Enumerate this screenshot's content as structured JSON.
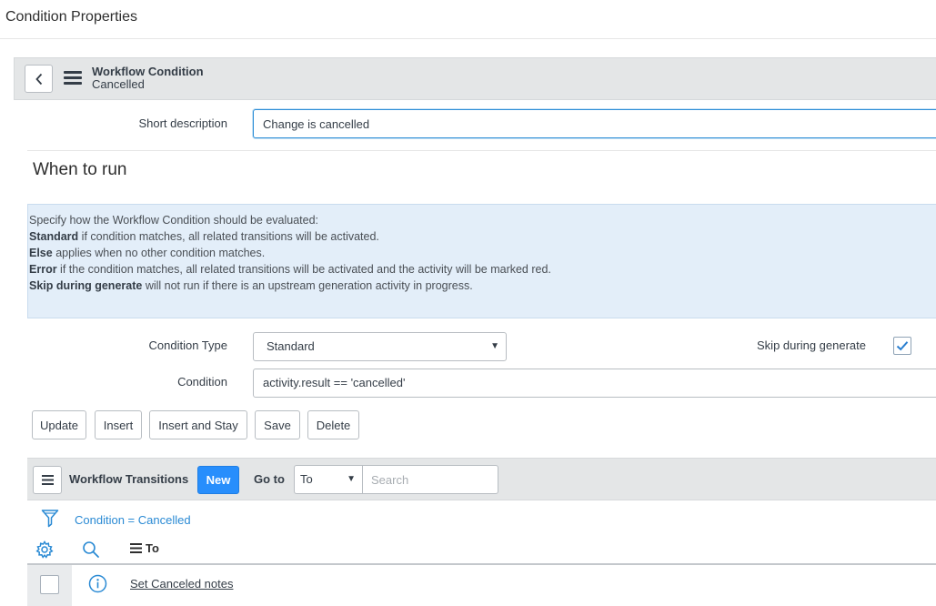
{
  "page": {
    "title": "Condition Properties"
  },
  "header": {
    "title": "Workflow Condition",
    "subtitle": "Cancelled"
  },
  "form": {
    "short_description": {
      "label": "Short description",
      "value": "Change is cancelled"
    },
    "when_to_run": {
      "heading": "When to run"
    },
    "info": {
      "intro": "Specify how the Workflow Condition should be evaluated:",
      "lines": [
        {
          "term": "Standard",
          "text": " if condition matches, all related transitions will be activated."
        },
        {
          "term": "Else",
          "text": " applies when no other condition matches."
        },
        {
          "term": "Error",
          "text": " if the condition matches, all related transitions will be activated and the activity will be marked red."
        },
        {
          "term": "Skip during generate",
          "text": " will not run if there is an upstream generation activity in progress."
        }
      ]
    },
    "condition_type": {
      "label": "Condition Type",
      "value": "Standard"
    },
    "skip_during_generate": {
      "label": "Skip during generate",
      "checked": true
    },
    "condition": {
      "label": "Condition",
      "value": "activity.result == 'cancelled'"
    },
    "buttons": {
      "update": "Update",
      "insert": "Insert",
      "insert_and_stay": "Insert and Stay",
      "save": "Save",
      "delete": "Delete"
    }
  },
  "related_list": {
    "title": "Workflow Transitions",
    "new_label": "New",
    "goto_label": "Go to",
    "goto_field": "To",
    "search_placeholder": "Search",
    "filter_breadcrumb": "Condition = Cancelled",
    "columns": [
      "To"
    ],
    "rows": [
      {
        "to": "Set Canceled notes"
      }
    ]
  },
  "colors": {
    "accent": "#278efc",
    "link": "#2a8ad4",
    "info_bg": "#e3eef9",
    "bar_bg": "#e4e6e7"
  },
  "icons": [
    "back-icon",
    "menu-icon",
    "checkmark-icon",
    "filter-icon",
    "gear-icon",
    "search-icon",
    "info-icon"
  ]
}
